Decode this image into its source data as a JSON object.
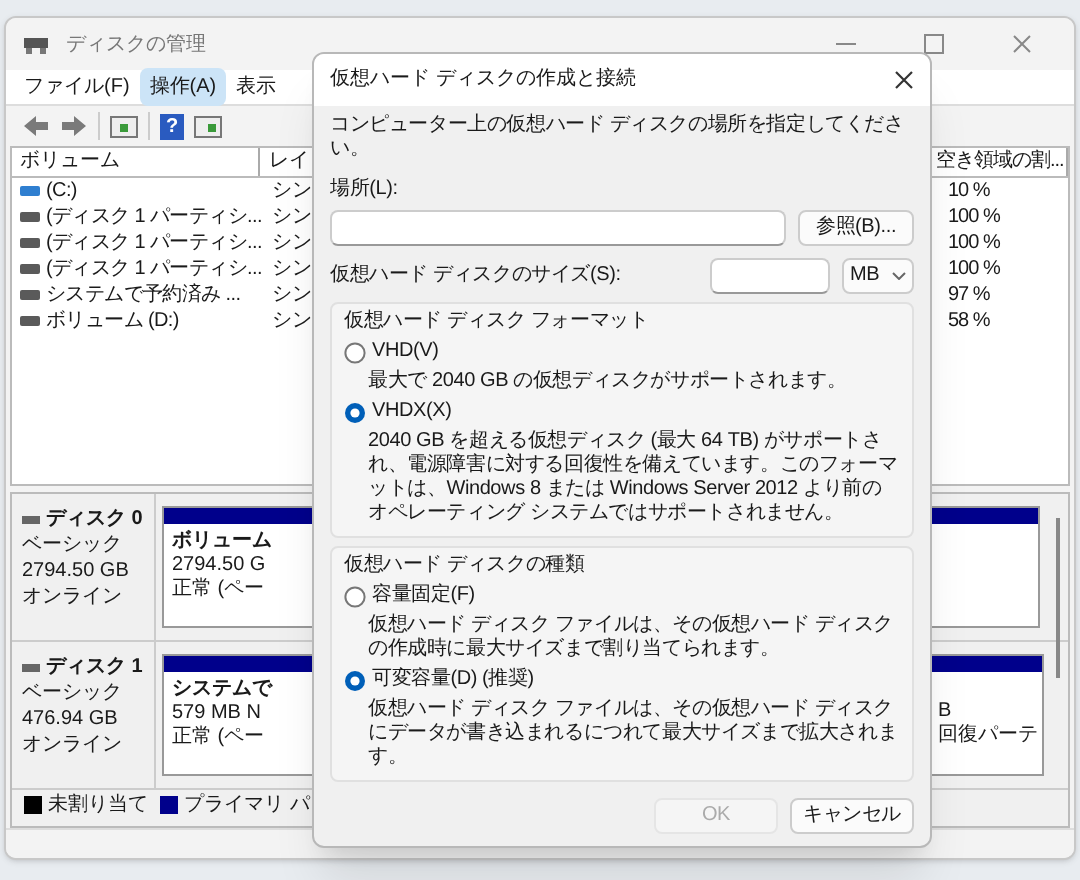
{
  "window": {
    "title": "ディスクの管理"
  },
  "menu": [
    {
      "label": "ファイル(F)",
      "selected": false
    },
    {
      "label": "操作(A)",
      "selected": true
    },
    {
      "label": "表示",
      "selected": false
    }
  ],
  "toolbar": {
    "help_glyph": "?"
  },
  "volume_table": {
    "columns": [
      "ボリューム",
      "レイ",
      "空き領域の割..."
    ],
    "rows": [
      {
        "volume": "(C:)",
        "layout": "シン",
        "free": "10 %",
        "color": "#2f7fd0"
      },
      {
        "volume": "(ディスク 1 パーティシ...",
        "layout": "シン",
        "free": "100 %",
        "color": "#5a5a5a"
      },
      {
        "volume": "(ディスク 1 パーティシ...",
        "layout": "シン",
        "free": "100 %",
        "color": "#5a5a5a"
      },
      {
        "volume": "(ディスク 1 パーティシ...",
        "layout": "シン",
        "free": "100 %",
        "color": "#5a5a5a"
      },
      {
        "volume": "システムで予約済み ...",
        "layout": "シン",
        "free": "97 %",
        "color": "#5a5a5a"
      },
      {
        "volume": "ボリューム (D:)",
        "layout": "シン",
        "free": "58 %",
        "color": "#5a5a5a"
      }
    ]
  },
  "disks": [
    {
      "name": "ディスク 0",
      "type": "ベーシック",
      "size": "2794.50 GB",
      "status": "オンライン",
      "partitions": [
        {
          "lines": [
            "ボリューム",
            "2794.50 G",
            "正常 (ペー"
          ]
        }
      ]
    },
    {
      "name": "ディスク 1",
      "type": "ベーシック",
      "size": "476.94 GB",
      "status": "オンライン",
      "partitions": [
        {
          "lines": [
            "システムで",
            "579 MB N",
            "正常 (ペー"
          ]
        },
        {
          "lines": [
            "B",
            "回復パーテ"
          ]
        }
      ]
    }
  ],
  "legend": [
    {
      "label": "未割り当て",
      "color": "#000000"
    },
    {
      "label": "プライマリ パ",
      "color": "#00008b"
    }
  ],
  "dialog": {
    "title": "仮想ハード ディスクの作成と接続",
    "instruction": "コンピューター上の仮想ハード ディスクの場所を指定してください。",
    "location_label": "場所(L):",
    "browse_button": "参照(B)...",
    "size_label": "仮想ハード ディスクのサイズ(S):",
    "size_unit": "MB",
    "groups": [
      {
        "title": "仮想ハード ディスク フォーマット",
        "options": [
          {
            "label": "VHD(V)",
            "selected": false,
            "description": "最大で 2040 GB の仮想ディスクがサポートされます。"
          },
          {
            "label": "VHDX(X)",
            "selected": true,
            "description": "2040 GB を超える仮想ディスク (最大 64 TB) がサポートされ、電源障害に対する回復性を備えています。このフォーマットは、Windows 8 または Windows Server 2012 より前のオペレーティング システムではサポートされません。"
          }
        ]
      },
      {
        "title": "仮想ハード ディスクの種類",
        "options": [
          {
            "label": "容量固定(F)",
            "selected": false,
            "description": "仮想ハード ディスク ファイルは、その仮想ハード ディスクの作成時に最大サイズまで割り当てられます。"
          },
          {
            "label": "可変容量(D) (推奨)",
            "selected": true,
            "description": "仮想ハード ディスク ファイルは、その仮想ハード ディスクにデータが書き込まれるにつれて最大サイズまで拡大されます。"
          }
        ]
      }
    ],
    "buttons": [
      {
        "label": "OK",
        "disabled": true
      },
      {
        "label": "キャンセル",
        "disabled": false
      }
    ]
  }
}
